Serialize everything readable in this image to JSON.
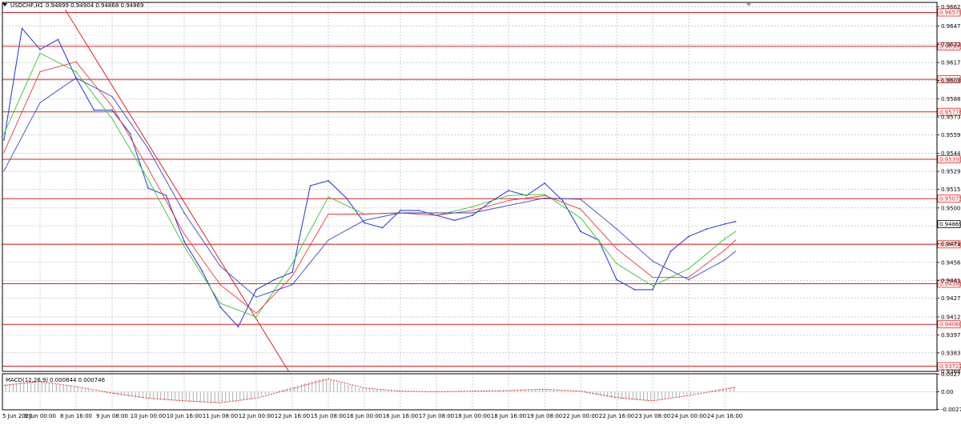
{
  "chart_info": {
    "symbol": "USDCHF,H1",
    "ohlc": "0.94899 0.94904 0.94868 0.94869"
  },
  "indicator_info": {
    "label": "MACD(12,26,9)",
    "values": "0.000844 0.000746"
  },
  "colors": {
    "price": "#3346d1",
    "ma_fast": "#2ec92e",
    "ma_mid": "#e53b3b",
    "ma_slow": "#3346d1",
    "level": "#e02020",
    "trend": "#e02020",
    "grid": "#b0b0b0",
    "macd_hist": "#9a9a9a",
    "macd_signal": "#e02020"
  },
  "chart_data": {
    "type": "line",
    "title": "",
    "xlabel": "",
    "ylabel": "",
    "ylim": [
      0.9368,
      0.9666
    ],
    "y_ticks": [
      "0.96625",
      "0.96470",
      "0.96320",
      "0.96175",
      "0.96030",
      "0.95880",
      "0.95735",
      "0.95590",
      "0.95440",
      "0.95295",
      "0.95150",
      "0.95000",
      "0.94855",
      "0.94710",
      "0.94560",
      "0.94415",
      "0.94270",
      "0.94120",
      "0.93975",
      "0.93830",
      "0.93680"
    ],
    "y_tick_values": [
      0.96625,
      0.9647,
      0.9632,
      0.96175,
      0.9603,
      0.9588,
      0.95735,
      0.9559,
      0.9544,
      0.95295,
      0.9515,
      0.95,
      0.94855,
      0.9471,
      0.9456,
      0.94415,
      0.9427,
      0.9412,
      0.93975,
      0.9383,
      0.9368
    ],
    "x_ticks": [
      "5 Jun 2020",
      "8 Jun 00:00",
      "8 Jun 16:00",
      "9 Jun 08:00",
      "10 Jun 00:00",
      "10 Jun 16:00",
      "11 Jun 08:00",
      "12 Jun 00:00",
      "12 Jun 16:00",
      "15 Jun 08:00",
      "16 Jun 00:00",
      "16 Jun 16:00",
      "17 Jun 08:00",
      "18 Jun 00:00",
      "18 Jun 16:00",
      "19 Jun 08:00",
      "22 Jun 00:00",
      "22 Jun 16:00",
      "23 Jun 08:00",
      "24 Jun 00:00",
      "24 Jun 16:00"
    ],
    "levels": [
      {
        "value": 0.96579,
        "label": "0.96579"
      },
      {
        "value": 0.96305,
        "label": "0.96305"
      },
      {
        "value": 0.96039,
        "label": "0.96039"
      },
      {
        "value": 0.95776,
        "label": "0.95776"
      },
      {
        "value": 0.95393,
        "label": "0.95393"
      },
      {
        "value": 0.95075,
        "label": "0.95075"
      },
      {
        "value": 0.94706,
        "label": "0.94706"
      },
      {
        "value": 0.94388,
        "label": "0.94388"
      },
      {
        "value": 0.9406,
        "label": "0.94060"
      },
      {
        "value": 0.93722,
        "label": "0.93722"
      }
    ],
    "current_price": {
      "value": 0.94869,
      "label": "0.94869"
    },
    "series": [
      {
        "x": [
          0,
          0.5,
          1,
          1.5,
          2,
          2.5,
          3,
          3.5,
          4,
          4.5,
          5,
          5.5,
          6,
          6.5,
          7,
          7.5,
          8,
          8.5,
          9,
          9.5,
          10,
          10.5,
          11,
          11.5,
          12,
          12.5,
          13,
          13.5,
          14,
          14.5,
          15,
          15.5,
          16,
          16.5,
          17,
          17.5,
          18,
          18.5,
          19,
          19.5,
          20,
          20.3
        ],
        "values": [
          0.9555,
          0.9645,
          0.9628,
          0.9636,
          0.9605,
          0.9579,
          0.9579,
          0.956,
          0.9516,
          0.951,
          0.9473,
          0.9449,
          0.942,
          0.9404,
          0.9434,
          0.9442,
          0.9448,
          0.9518,
          0.9522,
          0.9508,
          0.9488,
          0.9484,
          0.9498,
          0.9498,
          0.9494,
          0.949,
          0.9494,
          0.9505,
          0.9514,
          0.951,
          0.952,
          0.9506,
          0.9481,
          0.9474,
          0.9442,
          0.9434,
          0.9434,
          0.9465,
          0.9477,
          0.9483,
          0.9487,
          0.9489
        ]
      },
      {
        "x": [
          0,
          1,
          2,
          3,
          4,
          5,
          6,
          7,
          8,
          9,
          10,
          11,
          12,
          13,
          14,
          15,
          16,
          17,
          18,
          19,
          20,
          20.3
        ],
        "values": [
          0.956,
          0.9625,
          0.961,
          0.9572,
          0.9523,
          0.9469,
          0.9423,
          0.9412,
          0.9455,
          0.9509,
          0.9495,
          0.9496,
          0.9494,
          0.9501,
          0.951,
          0.9511,
          0.9492,
          0.9455,
          0.9437,
          0.9451,
          0.9475,
          0.9481
        ]
      },
      {
        "x": [
          0,
          1,
          2,
          3,
          4,
          5,
          6,
          7,
          8,
          9,
          10,
          11,
          12,
          13,
          14,
          15,
          16,
          17,
          18,
          19,
          20,
          20.3
        ],
        "values": [
          0.9545,
          0.961,
          0.9618,
          0.9582,
          0.9532,
          0.9479,
          0.9438,
          0.9415,
          0.9445,
          0.9495,
          0.9495,
          0.9496,
          0.9494,
          0.9498,
          0.9506,
          0.951,
          0.9499,
          0.9467,
          0.9444,
          0.9444,
          0.9466,
          0.9474
        ]
      },
      {
        "x": [
          0,
          1,
          2,
          3,
          4,
          5,
          6,
          7,
          8,
          9,
          10,
          11,
          12,
          13,
          14,
          15,
          16,
          17,
          18,
          19,
          20,
          20.3
        ],
        "values": [
          0.953,
          0.9585,
          0.9605,
          0.959,
          0.9548,
          0.9496,
          0.9453,
          0.9428,
          0.9438,
          0.9474,
          0.949,
          0.9496,
          0.9496,
          0.9496,
          0.9502,
          0.9508,
          0.9507,
          0.9483,
          0.9457,
          0.9442,
          0.9458,
          0.9465
        ]
      }
    ],
    "trendline": {
      "x": [
        1.7,
        7.9
      ],
      "values": [
        0.966,
        0.9368
      ]
    },
    "macd": {
      "ylim": [
        -0.0028,
        0.0028
      ],
      "y_ticks": [
        "0.002746",
        "0.00",
        "-0.002746"
      ],
      "y_tick_values": [
        0.002746,
        0,
        -0.002746
      ],
      "signal_x": [
        0,
        1,
        2,
        3,
        4,
        5,
        6,
        7,
        8,
        9,
        10,
        11,
        12,
        13,
        14,
        15,
        16,
        17,
        18,
        19,
        20,
        20.3
      ],
      "signal": [
        0.001,
        0.0016,
        0.0008,
        -0.0002,
        -0.001,
        -0.0014,
        -0.0017,
        -0.001,
        0.0005,
        0.002,
        0.0006,
        0.0001,
        0.0,
        0.0001,
        0.0002,
        0.0004,
        0.0001,
        -0.0009,
        -0.0014,
        -0.0006,
        0.0004,
        0.0007
      ]
    }
  }
}
